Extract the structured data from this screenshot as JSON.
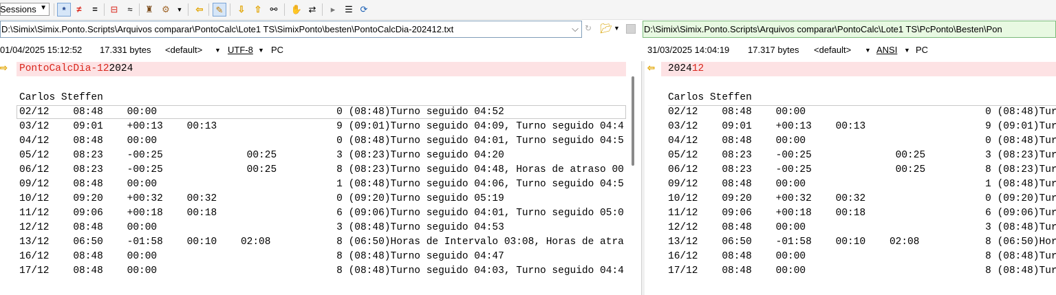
{
  "toolbar": {
    "sessions_label": "Sessions",
    "icons": [
      "asterisk-icon",
      "not-equal-icon",
      "equal-icon",
      "split-lines-icon",
      "approx-icon",
      "user-icon",
      "rules-icon",
      "prev-diff-icon",
      "edit-pencil-icon",
      "next-diff-down-icon",
      "prev-diff-up-icon",
      "binoculars-icon",
      "hand-icon",
      "swap-icon",
      "expand-icon",
      "list-icon",
      "refresh-icon"
    ]
  },
  "left": {
    "path": "D:\\Simix\\Simix.Ponto.Scripts\\Arquivos comparar\\PontoCalc\\Lote1 TS\\SimixPonto\\besten\\PontoCalcDia-202412.txt",
    "timestamp": "01/04/2025 15:12:52",
    "size": "17.331 bytes",
    "format": "<default>",
    "encoding": "UTF-8",
    "lineend": "PC",
    "title_diff": "PontoCalcDia-12",
    "title_same": "2024",
    "name": "Carlos Steffen",
    "rows": [
      "02/12    08:48    00:00                              0 (08:48)Turno seguido 04:52",
      "03/12    09:01    +00:13    00:13                    9 (09:01)Turno seguido 04:09, Turno seguido 04:4",
      "04/12    08:48    00:00                              0 (08:48)Turno seguido 04:01, Turno seguido 04:5",
      "05/12    08:23    -00:25              00:25          3 (08:23)Turno seguido 04:20",
      "06/12    08:23    -00:25              00:25          8 (08:23)Turno seguido 04:48, Horas de atraso 00",
      "09/12    08:48    00:00                              1 (08:48)Turno seguido 04:06, Turno seguido 04:5",
      "10/12    09:20    +00:32    00:32                    0 (09:20)Turno seguido 05:19",
      "11/12    09:06    +00:18    00:18                    6 (09:06)Turno seguido 04:01, Turno seguido 05:0",
      "12/12    08:48    00:00                              3 (08:48)Turno seguido 04:53",
      "13/12    06:50    -01:58    00:10    02:08           8 (06:50)Horas de Intervalo 03:08, Horas de atra",
      "16/12    08:48    00:00                              8 (08:48)Turno seguido 04:47",
      "17/12    08:48    00:00                              8 (08:48)Turno seguido 04:03, Turno seguido 04:4"
    ]
  },
  "right": {
    "path": "D:\\Simix\\Simix.Ponto.Scripts\\Arquivos comparar\\PontoCalc\\Lote1 TS\\PcPonto\\Besten\\Pon",
    "timestamp": "31/03/2025 14:04:19",
    "size": "17.317 bytes",
    "format": "<default>",
    "encoding": "ANSI",
    "lineend": "PC",
    "title_same": "2024",
    "title_diff": "12",
    "name": "Carlos Steffen",
    "rows": [
      "02/12    08:48    00:00                              0 (08:48)Turr",
      "03/12    09:01    +00:13    00:13                    9 (09:01)Turr",
      "04/12    08:48    00:00                              0 (08:48)Turr",
      "05/12    08:23    -00:25              00:25          3 (08:23)Turr",
      "06/12    08:23    -00:25              00:25          8 (08:23)Turr",
      "09/12    08:48    00:00                              1 (08:48)Turr",
      "10/12    09:20    +00:32    00:32                    0 (09:20)Turr",
      "11/12    09:06    +00:18    00:18                    6 (09:06)Turr",
      "12/12    08:48    00:00                              3 (08:48)Turr",
      "13/12    06:50    -01:58    00:10    02:08           8 (06:50)Hora",
      "16/12    08:48    00:00                              8 (08:48)Turr",
      "17/12    08:48    00:00                              8 (08:48)Turr"
    ]
  },
  "colors": {
    "diff_bg": "#fde2e4",
    "diff_text": "#d9261c",
    "right_path_bg": "#e8f9e2",
    "arrow": "#e2a400"
  }
}
